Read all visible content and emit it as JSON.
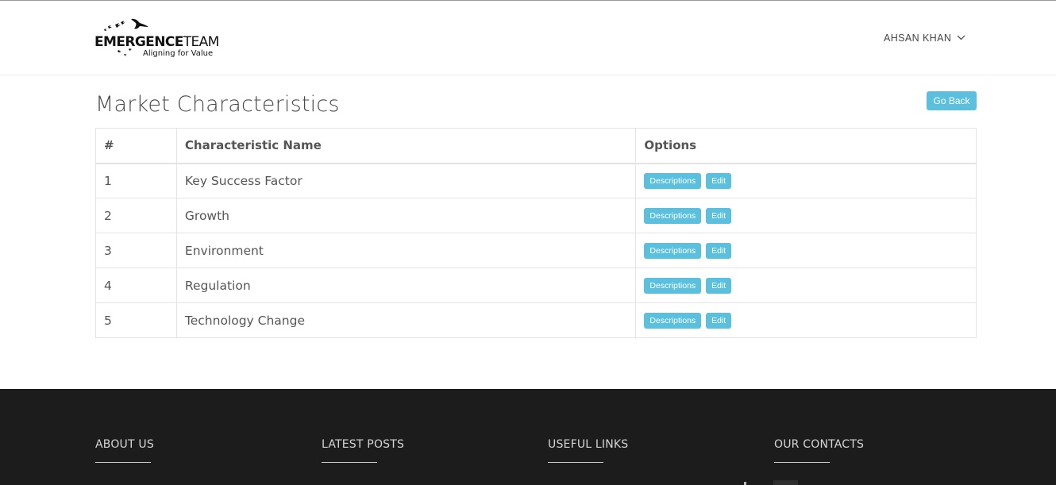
{
  "header": {
    "logo": {
      "brand_bold": "EMERGENCE",
      "brand_light": "TEAM",
      "tagline": "Aligning for Value"
    },
    "user_name": "AHSAN KHAN"
  },
  "page": {
    "title": "Market Characteristics",
    "go_back_label": "Go Back"
  },
  "table": {
    "columns": [
      "#",
      "Characteristic Name",
      "Options"
    ],
    "rows": [
      {
        "num": "1",
        "name": "Key Success Factor"
      },
      {
        "num": "2",
        "name": "Growth"
      },
      {
        "num": "3",
        "name": "Environment"
      },
      {
        "num": "4",
        "name": "Regulation"
      },
      {
        "num": "5",
        "name": "Technology Change"
      }
    ],
    "descriptions_label": "Descriptions",
    "edit_label": "Edit"
  },
  "footer": {
    "sections": [
      "ABOUT US",
      "LATEST POSTS",
      "USEFUL LINKS",
      "OUR CONTACTS"
    ]
  },
  "colors": {
    "accent": "#5bc0de",
    "footer_bg": "#1c1c1c"
  },
  "icons": {
    "user_menu": "chevron-down-icon",
    "logo": "birds-icon"
  }
}
